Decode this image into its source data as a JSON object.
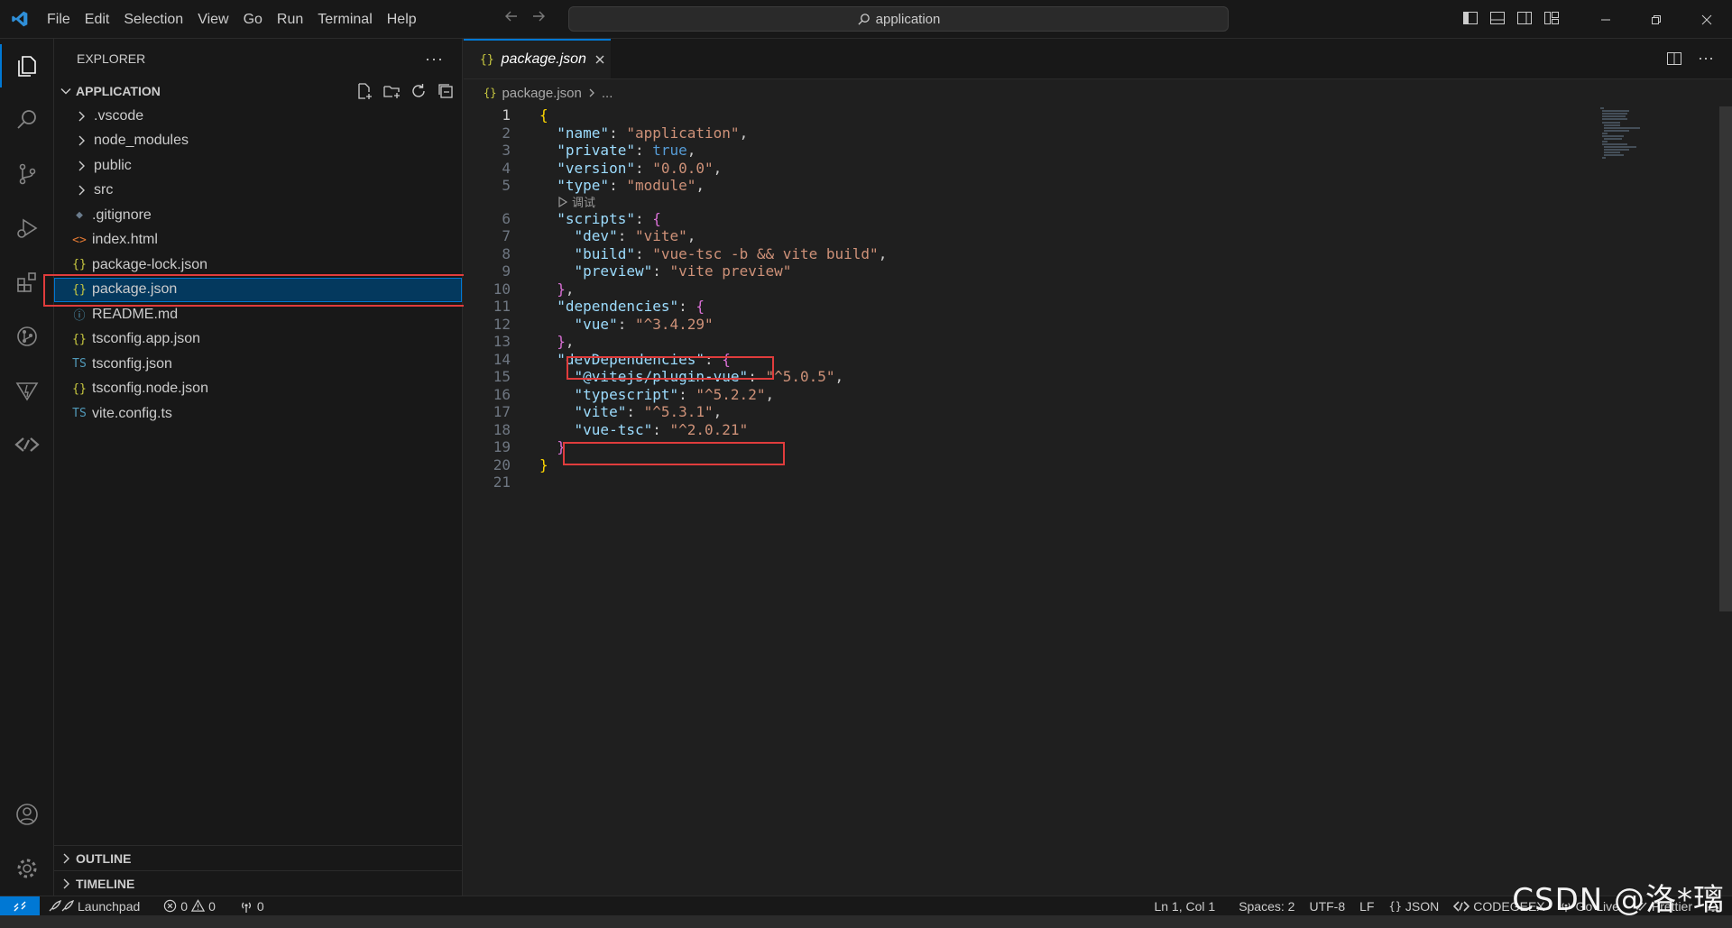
{
  "titlebar": {
    "menu": [
      "File",
      "Edit",
      "Selection",
      "View",
      "Go",
      "Run",
      "Terminal",
      "Help"
    ],
    "search_text": "application"
  },
  "activity_bar": {
    "icons": [
      "explorer-icon",
      "search-icon",
      "source-control-icon",
      "run-debug-icon",
      "extensions-icon",
      "git-graph-icon",
      "vite-icon",
      "codegeex-icon"
    ],
    "bottom_icons": [
      "accounts-icon",
      "settings-gear-icon"
    ]
  },
  "sidebar": {
    "title": "EXPLORER",
    "root": "APPLICATION",
    "items": [
      {
        "label": ".vscode",
        "kind": "folder"
      },
      {
        "label": "node_modules",
        "kind": "folder"
      },
      {
        "label": "public",
        "kind": "folder"
      },
      {
        "label": "src",
        "kind": "folder"
      },
      {
        "label": ".gitignore",
        "kind": "file",
        "icon": "◆",
        "color": "#6a7b8c"
      },
      {
        "label": "index.html",
        "kind": "file",
        "icon": "<>",
        "color": "#e37933"
      },
      {
        "label": "package-lock.json",
        "kind": "file",
        "icon": "{}",
        "color": "#cbcb41"
      },
      {
        "label": "package.json",
        "kind": "file",
        "icon": "{}",
        "color": "#cbcb41",
        "selected": true
      },
      {
        "label": "README.md",
        "kind": "file",
        "icon": "ⓘ",
        "color": "#519aba"
      },
      {
        "label": "tsconfig.app.json",
        "kind": "file",
        "icon": "{}",
        "color": "#cbcb41"
      },
      {
        "label": "tsconfig.json",
        "kind": "file",
        "icon": "TS",
        "color": "#519aba"
      },
      {
        "label": "tsconfig.node.json",
        "kind": "file",
        "icon": "{}",
        "color": "#cbcb41"
      },
      {
        "label": "vite.config.ts",
        "kind": "file",
        "icon": "TS",
        "color": "#519aba"
      }
    ],
    "outline": "OUTLINE",
    "timeline": "TIMELINE"
  },
  "editor": {
    "tab_label": "package.json",
    "breadcrumb_file": "package.json",
    "breadcrumb_more": "...",
    "codelens": "调试",
    "lines": [
      [
        [
          "br1",
          "{"
        ]
      ],
      [
        [
          "p",
          "  "
        ],
        [
          "k",
          "\"name\""
        ],
        [
          "p",
          ": "
        ],
        [
          "s",
          "\"application\""
        ],
        [
          "p",
          ","
        ]
      ],
      [
        [
          "p",
          "  "
        ],
        [
          "k",
          "\"private\""
        ],
        [
          "p",
          ": "
        ],
        [
          "b",
          "true"
        ],
        [
          "p",
          ","
        ]
      ],
      [
        [
          "p",
          "  "
        ],
        [
          "k",
          "\"version\""
        ],
        [
          "p",
          ": "
        ],
        [
          "s",
          "\"0.0.0\""
        ],
        [
          "p",
          ","
        ]
      ],
      [
        [
          "p",
          "  "
        ],
        [
          "k",
          "\"type\""
        ],
        [
          "p",
          ": "
        ],
        [
          "s",
          "\"module\""
        ],
        [
          "p",
          ","
        ]
      ],
      [
        [
          "p",
          "  "
        ],
        [
          "k",
          "\"scripts\""
        ],
        [
          "p",
          ": "
        ],
        [
          "br2",
          "{"
        ]
      ],
      [
        [
          "p",
          "    "
        ],
        [
          "k",
          "\"dev\""
        ],
        [
          "p",
          ": "
        ],
        [
          "s",
          "\"vite\""
        ],
        [
          "p",
          ","
        ]
      ],
      [
        [
          "p",
          "    "
        ],
        [
          "k",
          "\"build\""
        ],
        [
          "p",
          ": "
        ],
        [
          "s",
          "\"vue-tsc -b && vite build\""
        ],
        [
          "p",
          ","
        ]
      ],
      [
        [
          "p",
          "    "
        ],
        [
          "k",
          "\"preview\""
        ],
        [
          "p",
          ": "
        ],
        [
          "s",
          "\"vite preview\""
        ]
      ],
      [
        [
          "p",
          "  "
        ],
        [
          "br2",
          "}"
        ],
        [
          "p",
          ","
        ]
      ],
      [
        [
          "p",
          "  "
        ],
        [
          "k",
          "\"dependencies\""
        ],
        [
          "p",
          ": "
        ],
        [
          "br2",
          "{"
        ]
      ],
      [
        [
          "p",
          "    "
        ],
        [
          "k",
          "\"vue\""
        ],
        [
          "p",
          ": "
        ],
        [
          "s",
          "\"^3.4.29\""
        ]
      ],
      [
        [
          "p",
          "  "
        ],
        [
          "br2",
          "}"
        ],
        [
          "p",
          ","
        ]
      ],
      [
        [
          "p",
          "  "
        ],
        [
          "k",
          "\"devDependencies\""
        ],
        [
          "p",
          ": "
        ],
        [
          "br2",
          "{"
        ]
      ],
      [
        [
          "p",
          "    "
        ],
        [
          "k",
          "\"@vitejs/plugin-vue\""
        ],
        [
          "p",
          ": "
        ],
        [
          "s",
          "\"^5.0.5\""
        ],
        [
          "p",
          ","
        ]
      ],
      [
        [
          "p",
          "    "
        ],
        [
          "k",
          "\"typescript\""
        ],
        [
          "p",
          ": "
        ],
        [
          "s",
          "\"^5.2.2\""
        ],
        [
          "p",
          ","
        ]
      ],
      [
        [
          "p",
          "    "
        ],
        [
          "k",
          "\"vite\""
        ],
        [
          "p",
          ": "
        ],
        [
          "s",
          "\"^5.3.1\""
        ],
        [
          "p",
          ","
        ]
      ],
      [
        [
          "p",
          "    "
        ],
        [
          "k",
          "\"vue-tsc\""
        ],
        [
          "p",
          ": "
        ],
        [
          "s",
          "\"^2.0.21\""
        ]
      ],
      [
        [
          "p",
          "  "
        ],
        [
          "br2",
          "}"
        ]
      ],
      [
        [
          "br1",
          "}"
        ]
      ],
      []
    ]
  },
  "statusbar": {
    "launchpad": "Launchpad",
    "errors": "0",
    "warnings": "0",
    "ports": "0",
    "position": "Ln 1, Col 1",
    "spaces": "Spaces: 2",
    "encoding": "UTF-8",
    "eol": "LF",
    "language": "JSON",
    "codegeex": "CODEGEEX",
    "golive": "Go Live",
    "prettier": "Prettier"
  },
  "watermark": "CSDN @洛*璃",
  "colors": {
    "accent": "#0078d4",
    "highlight_box": "#e03c3c"
  }
}
